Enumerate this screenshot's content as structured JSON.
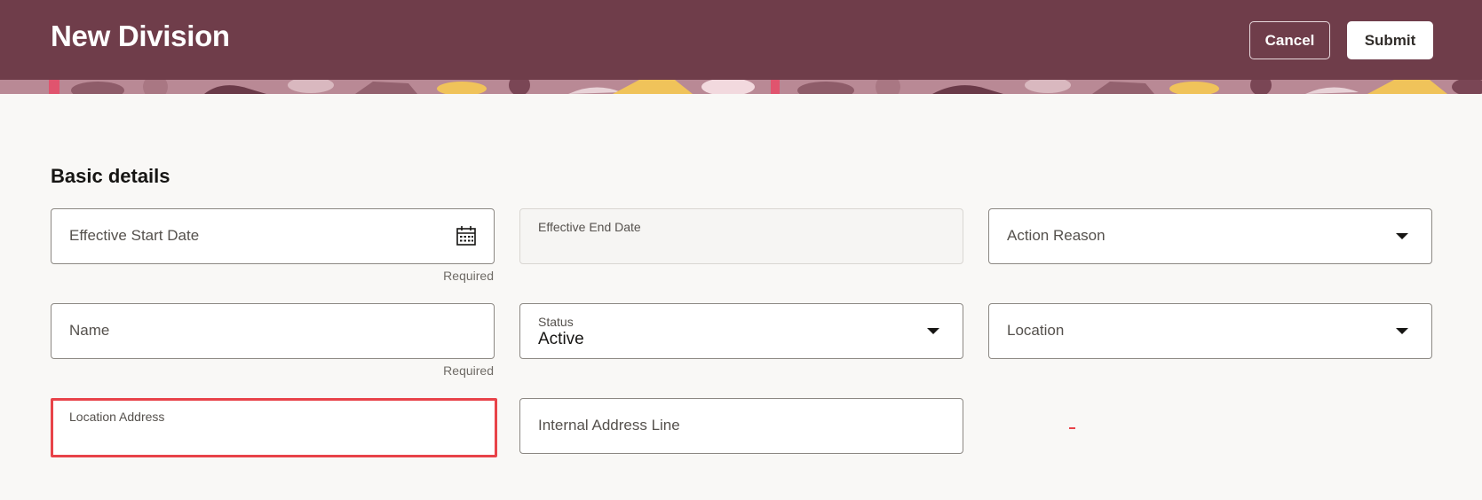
{
  "header": {
    "title": "New Division",
    "cancel_label": "Cancel",
    "submit_label": "Submit",
    "background_color": "#6f3d4a"
  },
  "section": {
    "title": "Basic details"
  },
  "fields": {
    "effective_start_date": {
      "label": "Effective Start Date",
      "value": "",
      "helper": "Required",
      "icon": "calendar-icon"
    },
    "effective_end_date": {
      "label": "Effective End Date",
      "value": "",
      "read_only": true
    },
    "action_reason": {
      "label": "Action Reason",
      "value": "",
      "icon": "chevron-down-icon"
    },
    "name": {
      "label": "Name",
      "value": "",
      "helper": "Required"
    },
    "status": {
      "label": "Status",
      "value": "Active",
      "icon": "chevron-down-icon"
    },
    "location": {
      "label": "Location",
      "value": "",
      "icon": "chevron-down-icon"
    },
    "location_address": {
      "label": "Location Address",
      "value": "",
      "highlight_color": "#e84349"
    },
    "internal_address_line": {
      "label": "Internal Address Line",
      "value": ""
    }
  }
}
